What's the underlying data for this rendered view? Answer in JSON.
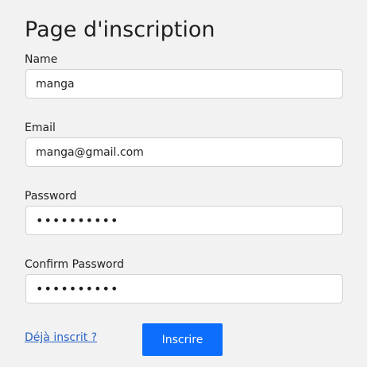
{
  "form": {
    "title": "Page d'inscription",
    "name_label": "Name",
    "name_value": "manga",
    "email_label": "Email",
    "email_value": "manga@gmail.com",
    "password_label": "Password",
    "password_value": "••••••••••",
    "confirm_label": "Confirm Password",
    "confirm_value": "••••••••••",
    "login_link": "Déjà inscrit ?",
    "submit_label": "Inscrire"
  },
  "colors": {
    "panel_background": "#f2f2f2",
    "button": "#0d6efd",
    "link": "#2a62c4"
  }
}
